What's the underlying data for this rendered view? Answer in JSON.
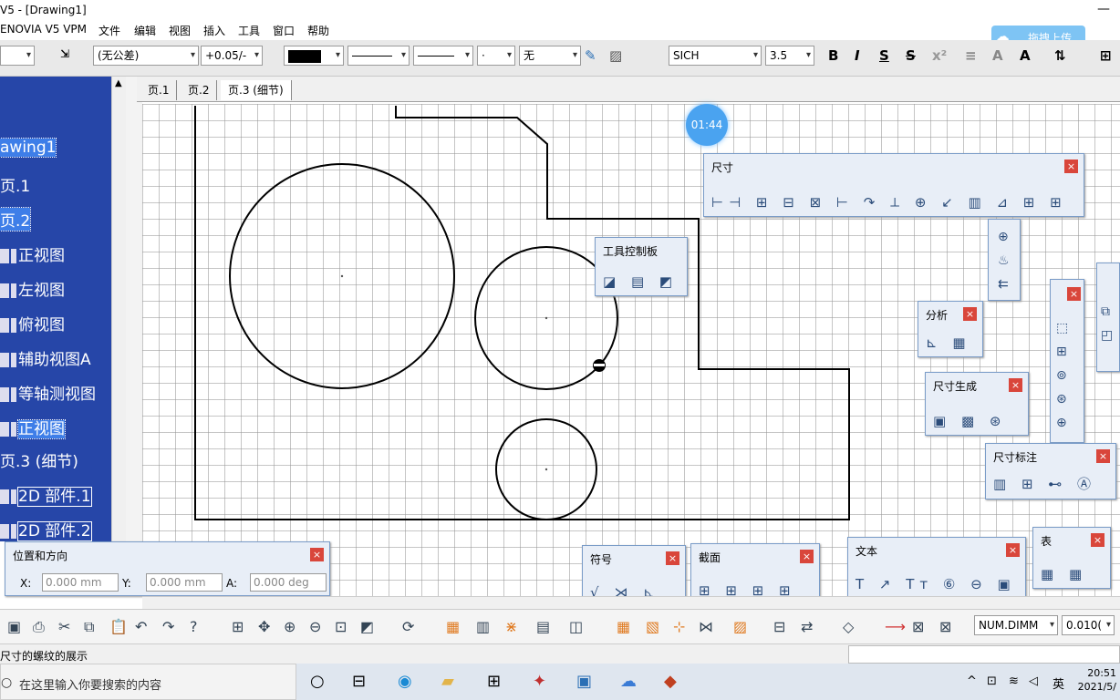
{
  "window": {
    "title": "V5 - [Drawing1]"
  },
  "menu": [
    "ENOVIA V5 VPM",
    "文件",
    "编辑",
    "视图",
    "插入",
    "工具",
    "窗口",
    "帮助"
  ],
  "upload_button": "拖拽上传",
  "toolbar": {
    "tolerance": "(无公差)",
    "precision": "+0.05/-",
    "line_weight": "·",
    "pattern": "无",
    "font": "SICH",
    "font_size": "3.5",
    "bold": "B",
    "italic": "I",
    "underline": "S",
    "strike": "S"
  },
  "tree": {
    "items": [
      "awing1",
      "页.1",
      "页.2",
      "正视图",
      "左视图",
      "俯视图",
      "辅助视图A",
      "等轴测视图",
      "正视图",
      "页.3 (细节)",
      "2D 部件.1",
      "2D 部件.2"
    ]
  },
  "tabs": [
    "页.1",
    "页.2",
    "页.3 (细节)"
  ],
  "timer": "01:44",
  "panels": {
    "dimension": "尺寸",
    "tool_palette": "工具控制板",
    "analysis": "分析",
    "dim_generation": "尺寸生成",
    "dim_annotation": "尺寸标注",
    "symbol": "符号",
    "section": "截面",
    "text": "文本",
    "table": "表"
  },
  "position": {
    "title": "位置和方向",
    "x_label": "X:",
    "x_value": "0.000 mm",
    "y_label": "Y:",
    "y_value": "0.000 mm",
    "a_label": "A:",
    "a_value": "0.000 deg"
  },
  "bottom": {
    "num_dim": "NUM.DIMM",
    "num_value": "0.010("
  },
  "status": "尺寸的螺纹的展示",
  "taskbar": {
    "search": "在这里输入你要搜索的内容",
    "ime": "英",
    "time": "20:51",
    "date": "2021/5/"
  }
}
